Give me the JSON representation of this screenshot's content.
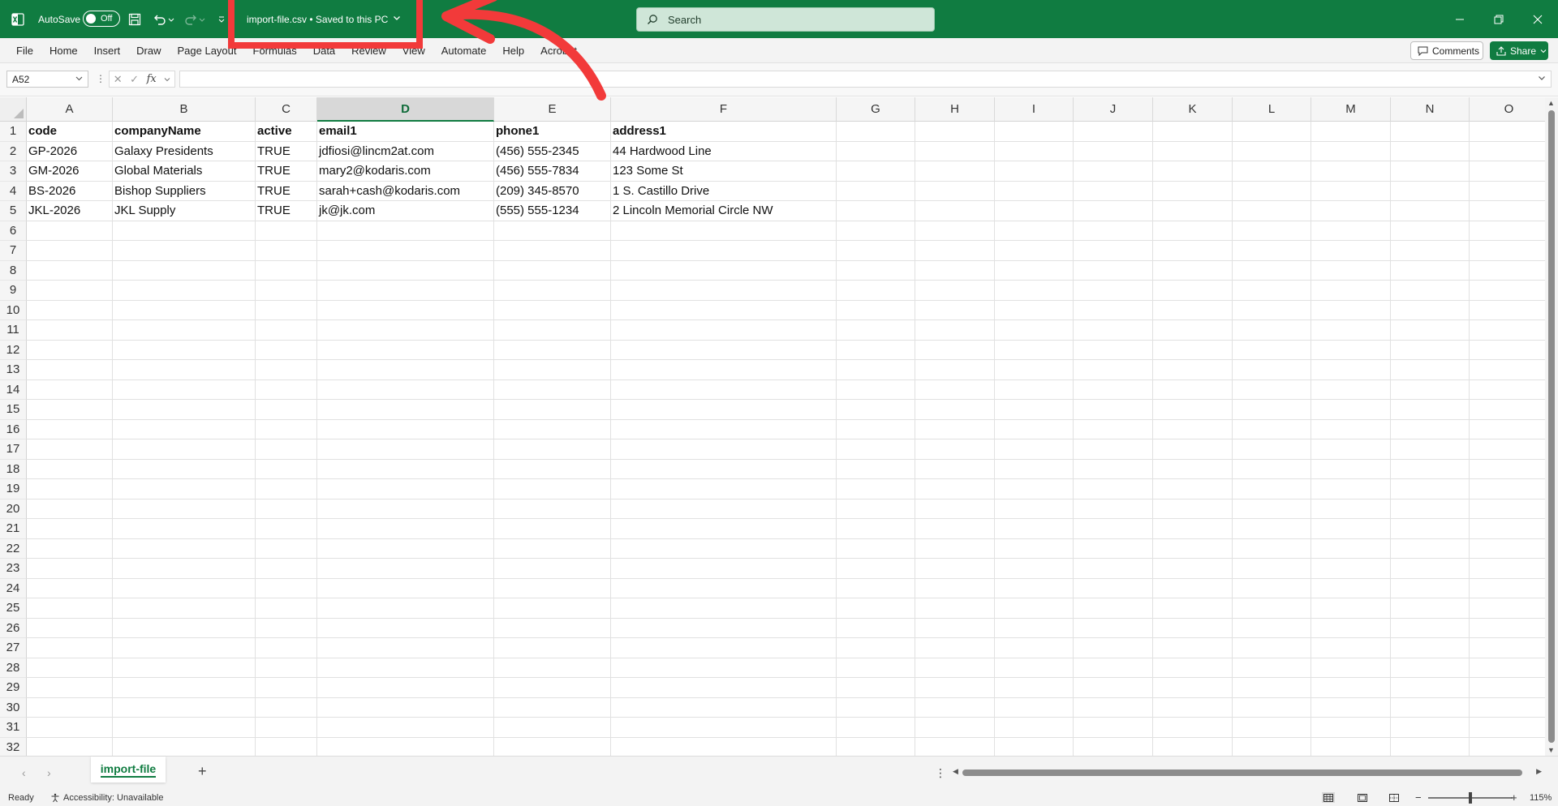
{
  "titlebar": {
    "autosave_label": "AutoSave",
    "autosave_state": "Off",
    "filename": "import-file.csv",
    "save_status": "• Saved to this PC",
    "search_placeholder": "Search",
    "accent_color": "#107c41"
  },
  "ribbon": {
    "tabs": [
      "File",
      "Home",
      "Insert",
      "Draw",
      "Page Layout",
      "Formulas",
      "Data",
      "Review",
      "View",
      "Automate",
      "Help",
      "Acrobat"
    ],
    "comments_label": "Comments",
    "share_label": "Share"
  },
  "formula_bar": {
    "name_box": "A52",
    "fx_label": "fx",
    "formula": ""
  },
  "grid": {
    "columns": [
      "A",
      "B",
      "C",
      "D",
      "E",
      "F",
      "G",
      "H",
      "I",
      "J",
      "K",
      "L",
      "M",
      "N",
      "O"
    ],
    "selected_column": "D",
    "row_numbers": [
      "1",
      "2",
      "3",
      "4",
      "5",
      "6",
      "7",
      "8",
      "9",
      "10",
      "11",
      "12",
      "13",
      "14",
      "15",
      "16",
      "17",
      "18",
      "19",
      "20",
      "21",
      "22",
      "23",
      "24",
      "25",
      "26",
      "27",
      "28",
      "29",
      "30",
      "31",
      "32"
    ],
    "header_row": [
      "code",
      "companyName",
      "active",
      "email1",
      "phone1",
      "address1"
    ],
    "data_rows": [
      [
        "GP-2026",
        "Galaxy Presidents",
        "TRUE",
        "jdfiosi@lincm2at.com",
        "(456) 555-2345",
        "44 Hardwood Line"
      ],
      [
        "GM-2026",
        "Global Materials",
        "TRUE",
        "mary2@kodaris.com",
        "(456) 555-7834",
        "123 Some St"
      ],
      [
        "BS-2026",
        "Bishop Suppliers",
        "TRUE",
        "sarah+cash@kodaris.com",
        "(209) 345-8570",
        "1 S. Castillo Drive"
      ],
      [
        "JKL-2026",
        "JKL Supply",
        "TRUE",
        "jk@jk.com",
        "(555) 555-1234",
        "2 Lincoln Memorial Circle NW"
      ]
    ]
  },
  "sheets": {
    "active": "import-file",
    "add_label": "+"
  },
  "statusbar": {
    "ready": "Ready",
    "accessibility": "Accessibility: Unavailable",
    "zoom": "115%"
  },
  "annotation": {
    "color": "#f23a3a"
  }
}
